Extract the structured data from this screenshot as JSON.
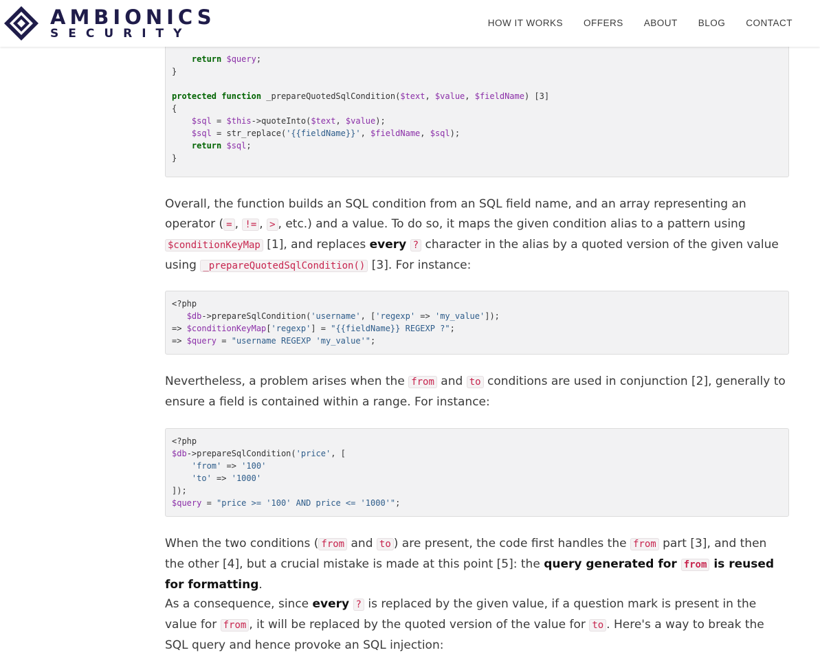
{
  "brand": {
    "line1": "AMBIONICS",
    "line2": "SECURITY"
  },
  "nav": [
    "HOW IT WORKS",
    "OFFERS",
    "ABOUT",
    "BLOG",
    "CONTACT"
  ],
  "code1": {
    "l1": "    return ",
    "l1v": "$query",
    "l1e": ";",
    "l2": "}",
    "l3kw": "protected function",
    "l3fn": " _prepareQuotedSqlCondition(",
    "l3a": "$text",
    "l3b": ", ",
    "l3c": "$value",
    "l3d": ", ",
    "l3e": "$fieldName",
    "l3f": ") [3]",
    "l4": "{",
    "l5a": "    ",
    "l5v": "$sql",
    "l5b": " = ",
    "l5t": "$this",
    "l5c": "->quoteInto(",
    "l5d": "$text",
    "l5e": ", ",
    "l5f": "$value",
    "l5g": ");",
    "l6a": "    ",
    "l6v": "$sql",
    "l6b": " = str_replace(",
    "l6s": "'{{fieldName}}'",
    "l6c": ", ",
    "l6d": "$fieldName",
    "l6e": ", ",
    "l6f": "$sql",
    "l6g": ");",
    "l7kw": "    return ",
    "l7v": "$sql",
    "l7e": ";",
    "l8": "}"
  },
  "para1": {
    "t1": "Overall, the function builds an SQL condition from an SQL field name, and an array representing an operator (",
    "c1": "=",
    "t2": ", ",
    "c2": "!=",
    "t3": ", ",
    "c3": ">",
    "t4": ", etc.) and a value. To do so, it maps the given condition alias to a pattern using ",
    "c4": "$conditionKeyMap",
    "t5": " [1], and replaces ",
    "b1": "every",
    "t6": " ",
    "c5": "?",
    "t7": " character in the alias by a quoted version of the given value using ",
    "c6": "_prepareQuotedSqlCondition()",
    "t8": " [3]. For instance:"
  },
  "code2": {
    "l1": "<?php",
    "l2a": "   ",
    "l2v": "$db",
    "l2b": "->prepareSqlCondition(",
    "l2s1": "'username'",
    "l2c": ", [",
    "l2s2": "'regexp'",
    "l2d": " => ",
    "l2s3": "'my_value'",
    "l2e": "]);",
    "l3a": "=> ",
    "l3v": "$conditionKeyMap",
    "l3b": "[",
    "l3s1": "'regexp'",
    "l3c": "] = ",
    "l3s2": "\"{{fieldName}} REGEXP ?\"",
    "l3d": ";",
    "l4a": "=> ",
    "l4v": "$query",
    "l4b": " = ",
    "l4s": "\"username REGEXP 'my_value'\"",
    "l4c": ";"
  },
  "para2": {
    "t1": "Nevertheless, a problem arises when the ",
    "c1": "from",
    "t2": " and ",
    "c2": "to",
    "t3": " conditions are used in conjunction [2], generally to ensure a field is contained within a range. For instance:"
  },
  "code3": {
    "l1": "<?php",
    "l2v": "$db",
    "l2b": "->prepareSqlCondition(",
    "l2s": "'price'",
    "l2c": ", [",
    "l3a": "    ",
    "l3s1": "'from'",
    "l3b": " => ",
    "l3s2": "'100'",
    "l4a": "    ",
    "l4s1": "'to'",
    "l4b": " => ",
    "l4s2": "'1000'",
    "l5": "]);",
    "l6v": "$query",
    "l6b": " = ",
    "l6s": "\"price >= '100' AND price <= '1000'\"",
    "l6c": ";"
  },
  "para3": {
    "t1": "When the two conditions (",
    "c1": "from",
    "t2": " and ",
    "c2": "to",
    "t3": ") are present, the code first handles the ",
    "c3": "from",
    "t4": " part [3], and then the other [4], but a crucial mistake is made at this point [5]: the ",
    "b1": "query generated for ",
    "c4": "from",
    "b2": " is reused for formatting",
    "t5": "."
  },
  "para4": {
    "t1": "As a consequence, since ",
    "b1": "every",
    "t2": " ",
    "c1": "?",
    "t3": " is replaced by the given value, if a question mark is present in the value for ",
    "c2": "from",
    "t4": ", it will be replaced by the quoted version of the value for ",
    "c3": "to",
    "t5": ". Here's a way to break the SQL query and hence provoke an SQL injection:"
  }
}
